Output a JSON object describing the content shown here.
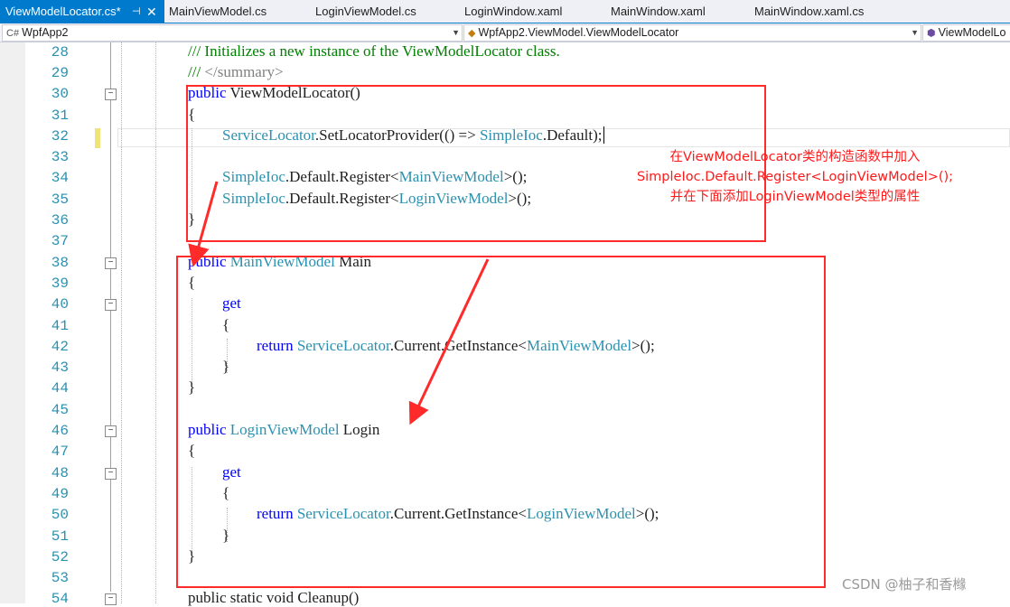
{
  "tabs": [
    {
      "label": "ViewModelLocator.cs*",
      "active": true
    },
    {
      "label": "MainViewModel.cs"
    },
    {
      "label": "LoginViewModel.cs"
    },
    {
      "label": "LoginWindow.xaml"
    },
    {
      "label": "MainWindow.xaml"
    },
    {
      "label": "MainWindow.xaml.cs"
    }
  ],
  "navbar": {
    "project": "WpfApp2",
    "type": "WpfApp2.ViewModel.ViewModelLocator",
    "member": "ViewModelLo"
  },
  "line_numbers": [
    "28",
    "29",
    "30",
    "31",
    "32",
    "33",
    "34",
    "35",
    "36",
    "37",
    "38",
    "39",
    "40",
    "41",
    "42",
    "43",
    "44",
    "45",
    "46",
    "47",
    "48",
    "49",
    "50",
    "51",
    "52",
    "53",
    "54"
  ],
  "code": {
    "l28": "/// Initializes a new instance of the ViewModelLocator class.",
    "l29_open": "/// ",
    "l29_tag": "</summary>",
    "public": "public",
    "ctor_name": "ViewModelLocator",
    "parens": "()",
    "brace_open": "{",
    "brace_close": "}",
    "service_locator": "ServiceLocator",
    "l32_mid": ".SetLocatorProvider(() => ",
    "simple_ioc": "SimpleIoc",
    "l32_end": ".Default);",
    "register": ".Default.Register",
    "main_vm": "MainViewModel",
    "login_vm": "LoginViewModel",
    "lt": "<",
    "gt_call": ">();",
    "main_prop": " Main",
    "login_prop": " Login",
    "get": "get",
    "return": "return",
    "current_get": ".Current.GetInstance",
    "l54": "public static void Cleanup()"
  },
  "annotation": {
    "line1": "在ViewModelLocator类的构造函数中加入",
    "line2": "SimpleIoc.Default.Register<LoginViewModel>();",
    "line3": "并在下面添加LoginViewModel类型的属性"
  },
  "watermark": "CSDN @柚子和香橼",
  "colors": {
    "tab_active": "#007acc",
    "keyword": "#0000ff",
    "type": "#2b91af",
    "comment": "#008000",
    "annotation": "#ff1a1a"
  }
}
